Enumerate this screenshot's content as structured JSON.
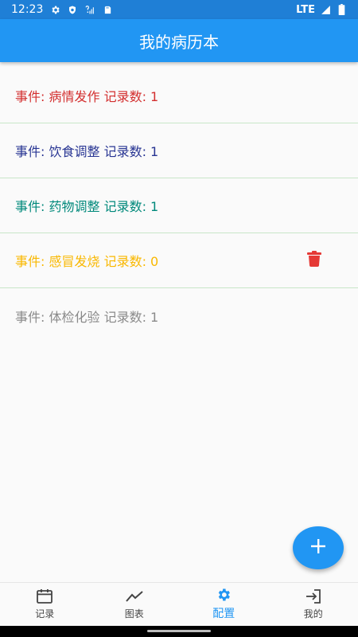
{
  "status_bar": {
    "time": "12:23",
    "network": "LTE",
    "icons": [
      "settings-icon",
      "shield-icon",
      "signal-question-icon",
      "sd-card-icon",
      "cell-signal-icon",
      "battery-icon"
    ]
  },
  "app_bar": {
    "title": "我的病历本"
  },
  "events": [
    {
      "label": "事件: 病情发作 记录数: 1",
      "color": "#d32f2f"
    },
    {
      "label": "事件: 饮食调整 记录数: 1",
      "color": "#283593"
    },
    {
      "label": "事件: 药物调整 记录数: 1",
      "color": "#00897b"
    },
    {
      "label": "事件: 感冒发烧 记录数: 0",
      "color": "#f9b800",
      "delete_icon": "trash-icon"
    },
    {
      "label": "事件: 体检化验 记录数: 1",
      "color": "#8a8a8a"
    }
  ],
  "fab": {
    "icon": "plus-icon"
  },
  "bottom_nav": [
    {
      "label": "记录",
      "icon": "calendar-icon",
      "active": false
    },
    {
      "label": "图表",
      "icon": "trend-chart-icon",
      "active": false
    },
    {
      "label": "配置",
      "icon": "gear-icon",
      "active": true
    },
    {
      "label": "我的",
      "icon": "login-icon",
      "active": false
    }
  ],
  "colors": {
    "primary": "#2196f3",
    "status_bar": "#1f7fd6",
    "divider": "#c8e6c9",
    "delete": "#e53935"
  }
}
